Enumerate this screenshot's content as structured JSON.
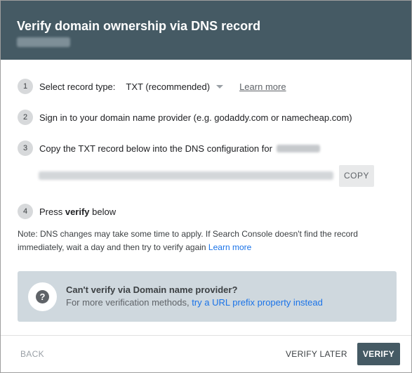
{
  "header": {
    "title": "Verify domain ownership via DNS record"
  },
  "steps": [
    {
      "num": "1",
      "label": "Select record type:",
      "select_value": "TXT (recommended)",
      "link": "Learn more"
    },
    {
      "num": "2",
      "label": "Sign in to your domain name provider (e.g. godaddy.com or namecheap.com)"
    },
    {
      "num": "3",
      "label": "Copy the TXT record below into the DNS configuration for",
      "copy_label": "COPY"
    },
    {
      "num": "4",
      "label_prefix": "Press ",
      "label_bold": "verify",
      "label_suffix": " below"
    }
  ],
  "note": {
    "text": "Note: DNS changes may take some time to apply. If Search Console doesn't find the record immediately, wait a day and then try to verify again",
    "link": "Learn more"
  },
  "banner": {
    "icon": "help-icon",
    "title": "Can't verify via Domain name provider?",
    "desc_prefix": "For more verification methods,",
    "link": "try a URL prefix property instead"
  },
  "footer": {
    "back": "BACK",
    "verify_later": "VERIFY LATER",
    "verify": "VERIFY"
  },
  "colors": {
    "header_bg": "#455a64",
    "banner_bg": "#cfd8de",
    "link": "#1a73e8"
  }
}
